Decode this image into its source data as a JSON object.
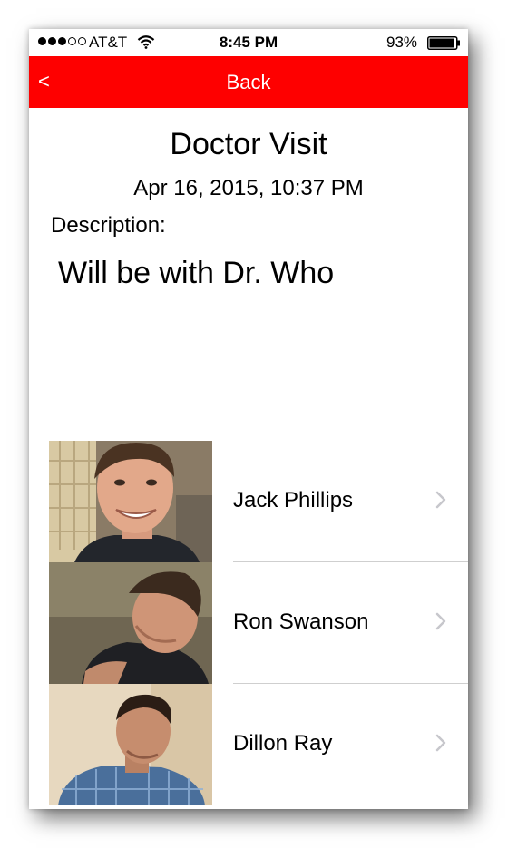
{
  "status_bar": {
    "carrier": "AT&T",
    "time": "8:45 PM",
    "battery": "93%",
    "signal_bars_filled": 3,
    "signal_bars_total": 5,
    "battery_level": 0.93
  },
  "nav": {
    "back_chevron": "<",
    "title": "Back",
    "color": "#fe0000"
  },
  "event": {
    "title": "Doctor Visit",
    "date": "Apr 16, 2015, 10:37 PM",
    "description_label": "Description:",
    "description": "Will be with Dr. Who"
  },
  "people": [
    {
      "name": "Jack Phillips",
      "icon": "chevron-right-icon"
    },
    {
      "name": "Ron Swanson",
      "icon": "chevron-right-icon"
    },
    {
      "name": "Dillon Ray",
      "icon": "chevron-right-icon"
    }
  ]
}
